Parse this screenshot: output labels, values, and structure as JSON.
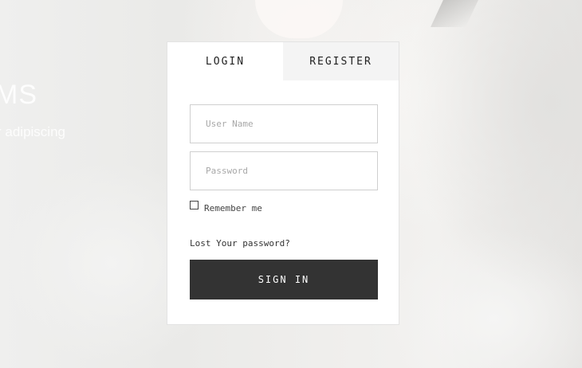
{
  "background": {
    "heading_fragment": "MS",
    "subtext_fragment": "r adipiscing"
  },
  "tabs": [
    {
      "label": "LOGIN",
      "active": true
    },
    {
      "label": "REGISTER",
      "active": false
    }
  ],
  "form": {
    "username": {
      "value": "",
      "placeholder": "User Name"
    },
    "password": {
      "value": "",
      "placeholder": "Password"
    },
    "remember": {
      "label": "Remember me",
      "checked": false
    },
    "lost_password_label": "Lost Your password?",
    "submit_label": "SIGN IN"
  },
  "colors": {
    "button_bg": "#333333",
    "button_text": "#ffffff",
    "card_bg": "#ffffff",
    "inactive_tab_bg": "#f4f4f4",
    "input_border": "#cfcfcf"
  },
  "icons": {
    "remember_checkbox": "checkbox-unchecked-icon"
  }
}
